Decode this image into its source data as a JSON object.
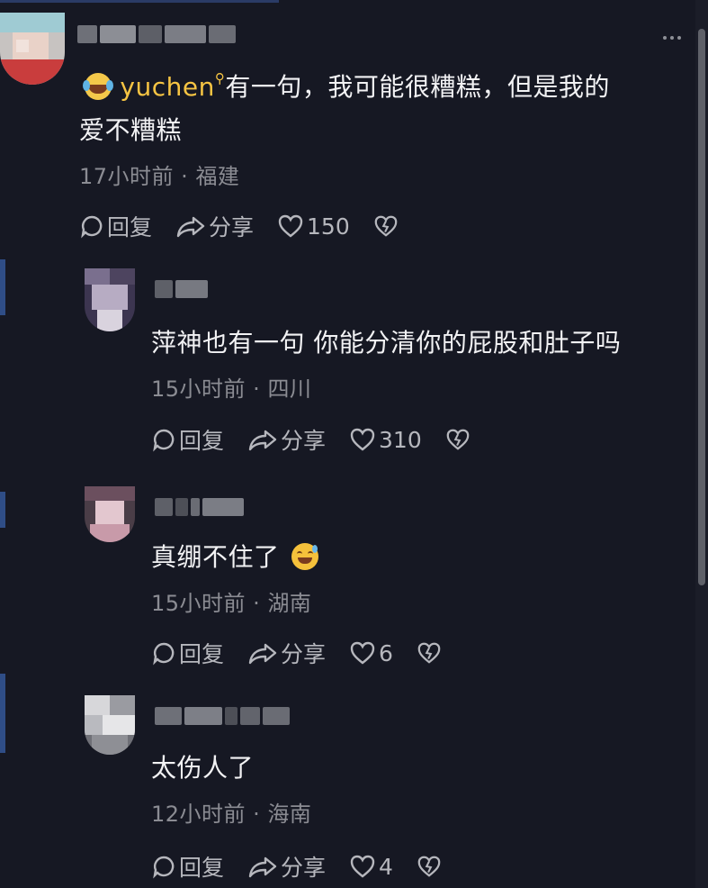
{
  "comments": [
    {
      "mention": "yuchen",
      "text_line1": "有一句，我可能很糟糕，但是我的",
      "text_line2": "爱不糟糕",
      "time": "17小时前",
      "location": "福建",
      "reply_label": "回复",
      "share_label": "分享",
      "likes": "150"
    },
    {
      "text": "萍神也有一句 你能分清你的屁股和肚子吗",
      "time": "15小时前",
      "location": "四川",
      "reply_label": "回复",
      "share_label": "分享",
      "likes": "310"
    },
    {
      "text": "真绷不住了",
      "emoji": "grinning-sweat-emoji",
      "time": "15小时前",
      "location": "湖南",
      "reply_label": "回复",
      "share_label": "分享",
      "likes": "6"
    },
    {
      "text": "太伤人了",
      "time": "12小时前",
      "location": "海南",
      "reply_label": "回复",
      "share_label": "分享",
      "likes": "4"
    }
  ],
  "meta_separator": " · ",
  "colors": {
    "background": "#161823",
    "mention": "#f6c443",
    "meta": "#8b8c93",
    "text": "#f2f2f4"
  }
}
